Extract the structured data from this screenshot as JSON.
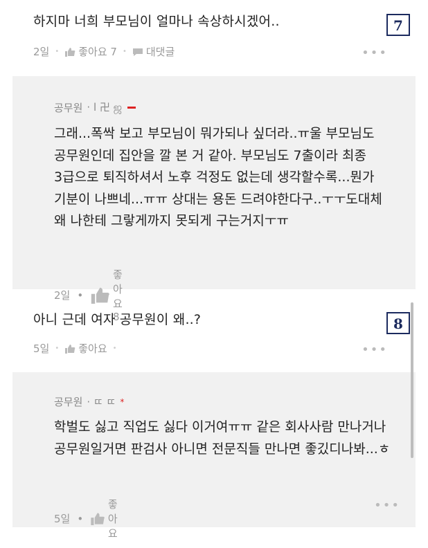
{
  "comments": [
    {
      "text": "하지마 너희 부모님이 얼마나 속상하시겠어..",
      "time": "2일",
      "likes_label": "좋아요 7",
      "reply_label": "대댓글",
      "badge": "7",
      "more": "•••",
      "reply": {
        "author": "공무원",
        "author_extra": "· l 卍 ஜ",
        "text": "그래...폭싹 보고 부모님이 뭐가되나 싶더라..ㅠ울 부모님도 공무원인데 집안을 깔 본 거 같아. 부모님도 7출이라 최종 3급으로 퇴직하셔서 노후 걱정도 없는데 생각할수록...뭔가 기분이 나쁘네...ㅠㅠ 상대는 용돈 드려야한다구..ㅜㅜ도대체 왜 나한테 그랗게까지 못되게 구는거지ㅜㅠ",
        "time": "2일",
        "likes_label": "좋아요 8"
      }
    },
    {
      "text": "아니 근데 여자 공무원이 왜..?",
      "time": "5일",
      "likes_label": "좋아요",
      "badge": "8",
      "more": "•••",
      "reply": {
        "author": "공무원",
        "author_extra": "· ㄸ ㄸ",
        "author_mark": "*",
        "text": "학벌도 싫고 직업도 싫다 이거여ㅠㅠ 같은 회사사람 만나거나 공무원일거면 판검사 아니면 전문직들 만나면 좋깄디나봐...ㅎ",
        "time": "5일",
        "likes_label": "좋아요",
        "more": "•••"
      }
    }
  ],
  "colors": {
    "badge": "#1b2a5e",
    "reply_bg": "#f1f1f1",
    "meta": "#999999"
  },
  "icons": {
    "like": "thumbs-up-icon",
    "reply": "speech-bubble-icon",
    "more": "more-dots-icon"
  }
}
